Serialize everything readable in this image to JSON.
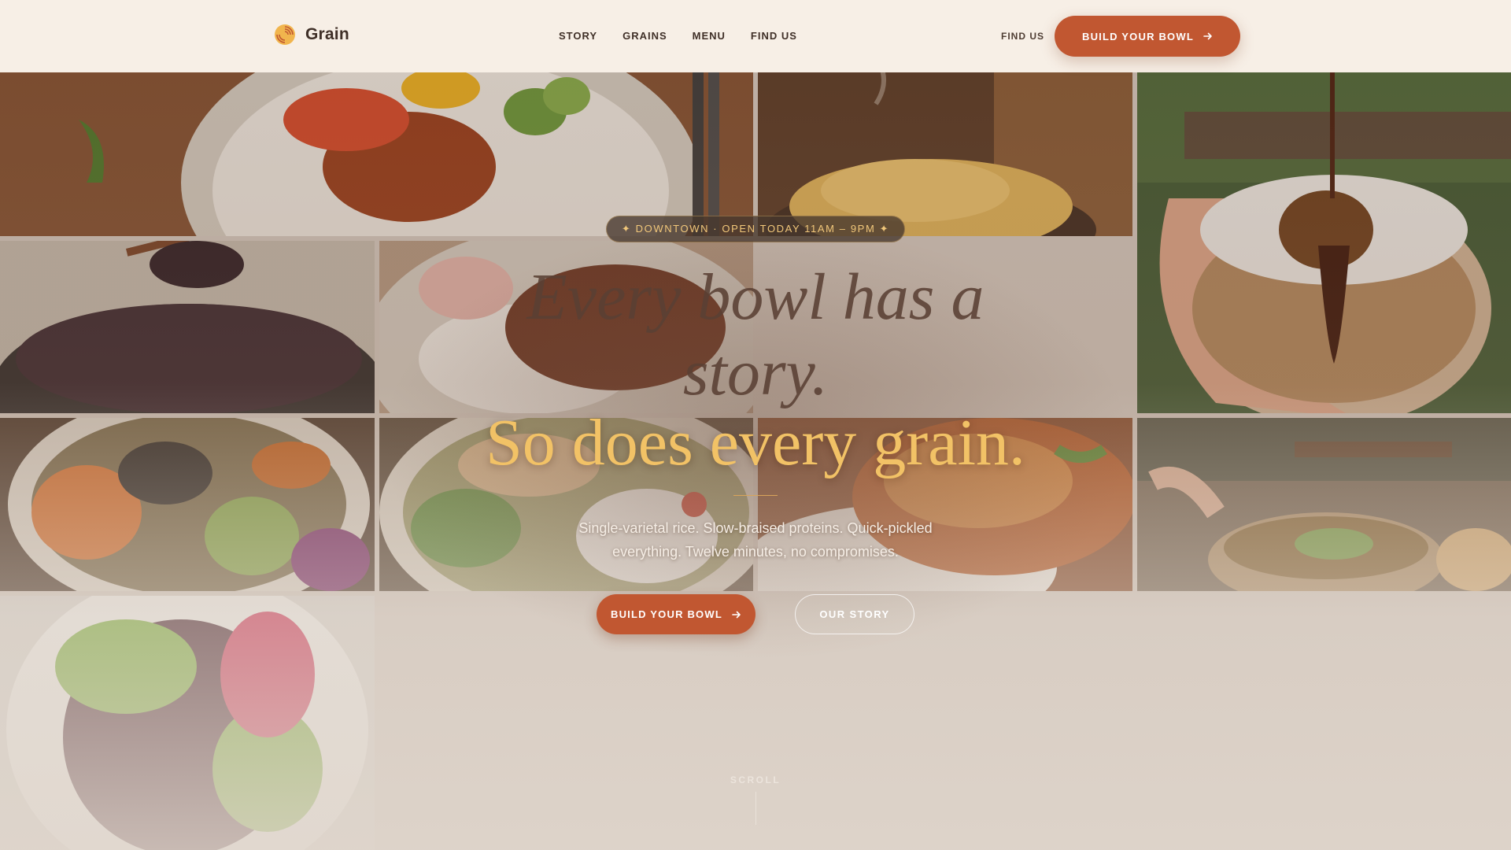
{
  "nav": {
    "brand": "Grain",
    "links": [
      "STORY",
      "GRAINS",
      "MENU",
      "FIND US"
    ],
    "find_us": "FIND US",
    "cta": "BUILD YOUR BOWL"
  },
  "hero": {
    "badge": "✦ DOWNTOWN · OPEN TODAY 11AM – 9PM ✦",
    "headline_line1": "Every bowl has a",
    "headline_line1b": "story.",
    "headline_line2": "So does every grain.",
    "subcopy": "Single-varietal rice. Slow-braised proteins. Quick-pickled everything. Twelve minutes, no compromises.",
    "primary_button": "BUILD YOUR BOWL",
    "secondary_button": "OUR STORY",
    "scroll": "SCROLL"
  },
  "colors": {
    "accent": "#c15731",
    "gold": "#f2c266",
    "nav_bg": "#f7efe6",
    "text_dark": "#3f2f27"
  },
  "icons": {
    "brand": "grain-swirl-icon",
    "arrow": "arrow-right-icon"
  },
  "photos": [
    "pork-belly-kimchi-bowl",
    "steaming-fried-rice",
    "sauce-drizzle-bowl-in-hand",
    "black-rice-with-chopsticks",
    "braised-beef-rice-bowl",
    "grain-bowl-avocado",
    "chicken-herb-grain-bowl",
    "glazed-chicken-rice",
    "outdoor-dining-bowl",
    "purple-rice-edamame-bowl"
  ]
}
